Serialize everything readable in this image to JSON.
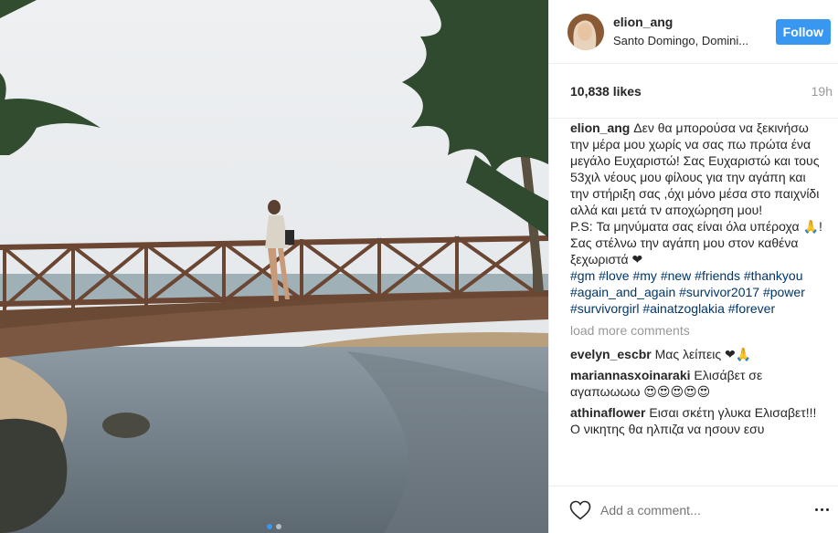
{
  "post": {
    "username": "elion_ang",
    "location": "Santo Domingo, Domini...",
    "follow_label": "Follow",
    "likes": "10,838 likes",
    "time": "19h"
  },
  "caption": {
    "username": "elion_ang",
    "text": "Δεν θα μπορούσα να ξεκινήσω την μέρα μου χωρίς να σας πω πρώτα ένα μεγάλο Ευχαριστώ! Σας Ευχαριστώ και τους 53χιλ νέους μου φίλους για την αγάπη και την στήριξη σας ,όχι μόνο μέσα στο παιχνίδι αλλά και μετά τν αποχώρηση μου!\nP.S: Τα μηνύματα σας είναι όλα υπέροχα 🙏! Σας στέλνω την αγάπη μου στον καθένα ξεχωριστά ❤",
    "hashtags": "#gm #love #my #new #friends #thankyou #again_and_again #survivor2017 #power #survivorgirl #ainatzoglakia #forever"
  },
  "load_more": "load more comments",
  "comments": [
    {
      "user": "evelyn_escbr",
      "text": "Μας λείπεις ❤🙏"
    },
    {
      "user": "mariannasxoinaraki",
      "text": "Ελισάβετ σε αγαπωωωω 😍😍😍😍😍"
    },
    {
      "user": "athinaflower",
      "text": "Εισαι σκέτη γλυκα Ελισαβετ!!! Ο νικητης θα ηλπιζα να ησουν εσυ"
    }
  ],
  "input": {
    "placeholder": "Add a comment..."
  },
  "icons": {
    "like": "heart-icon",
    "options": "more-options-icon"
  },
  "colors": {
    "accent": "#3897f0",
    "hashtag": "#003569",
    "muted": "#999999"
  },
  "carousel": {
    "count": 2,
    "active": 1
  }
}
